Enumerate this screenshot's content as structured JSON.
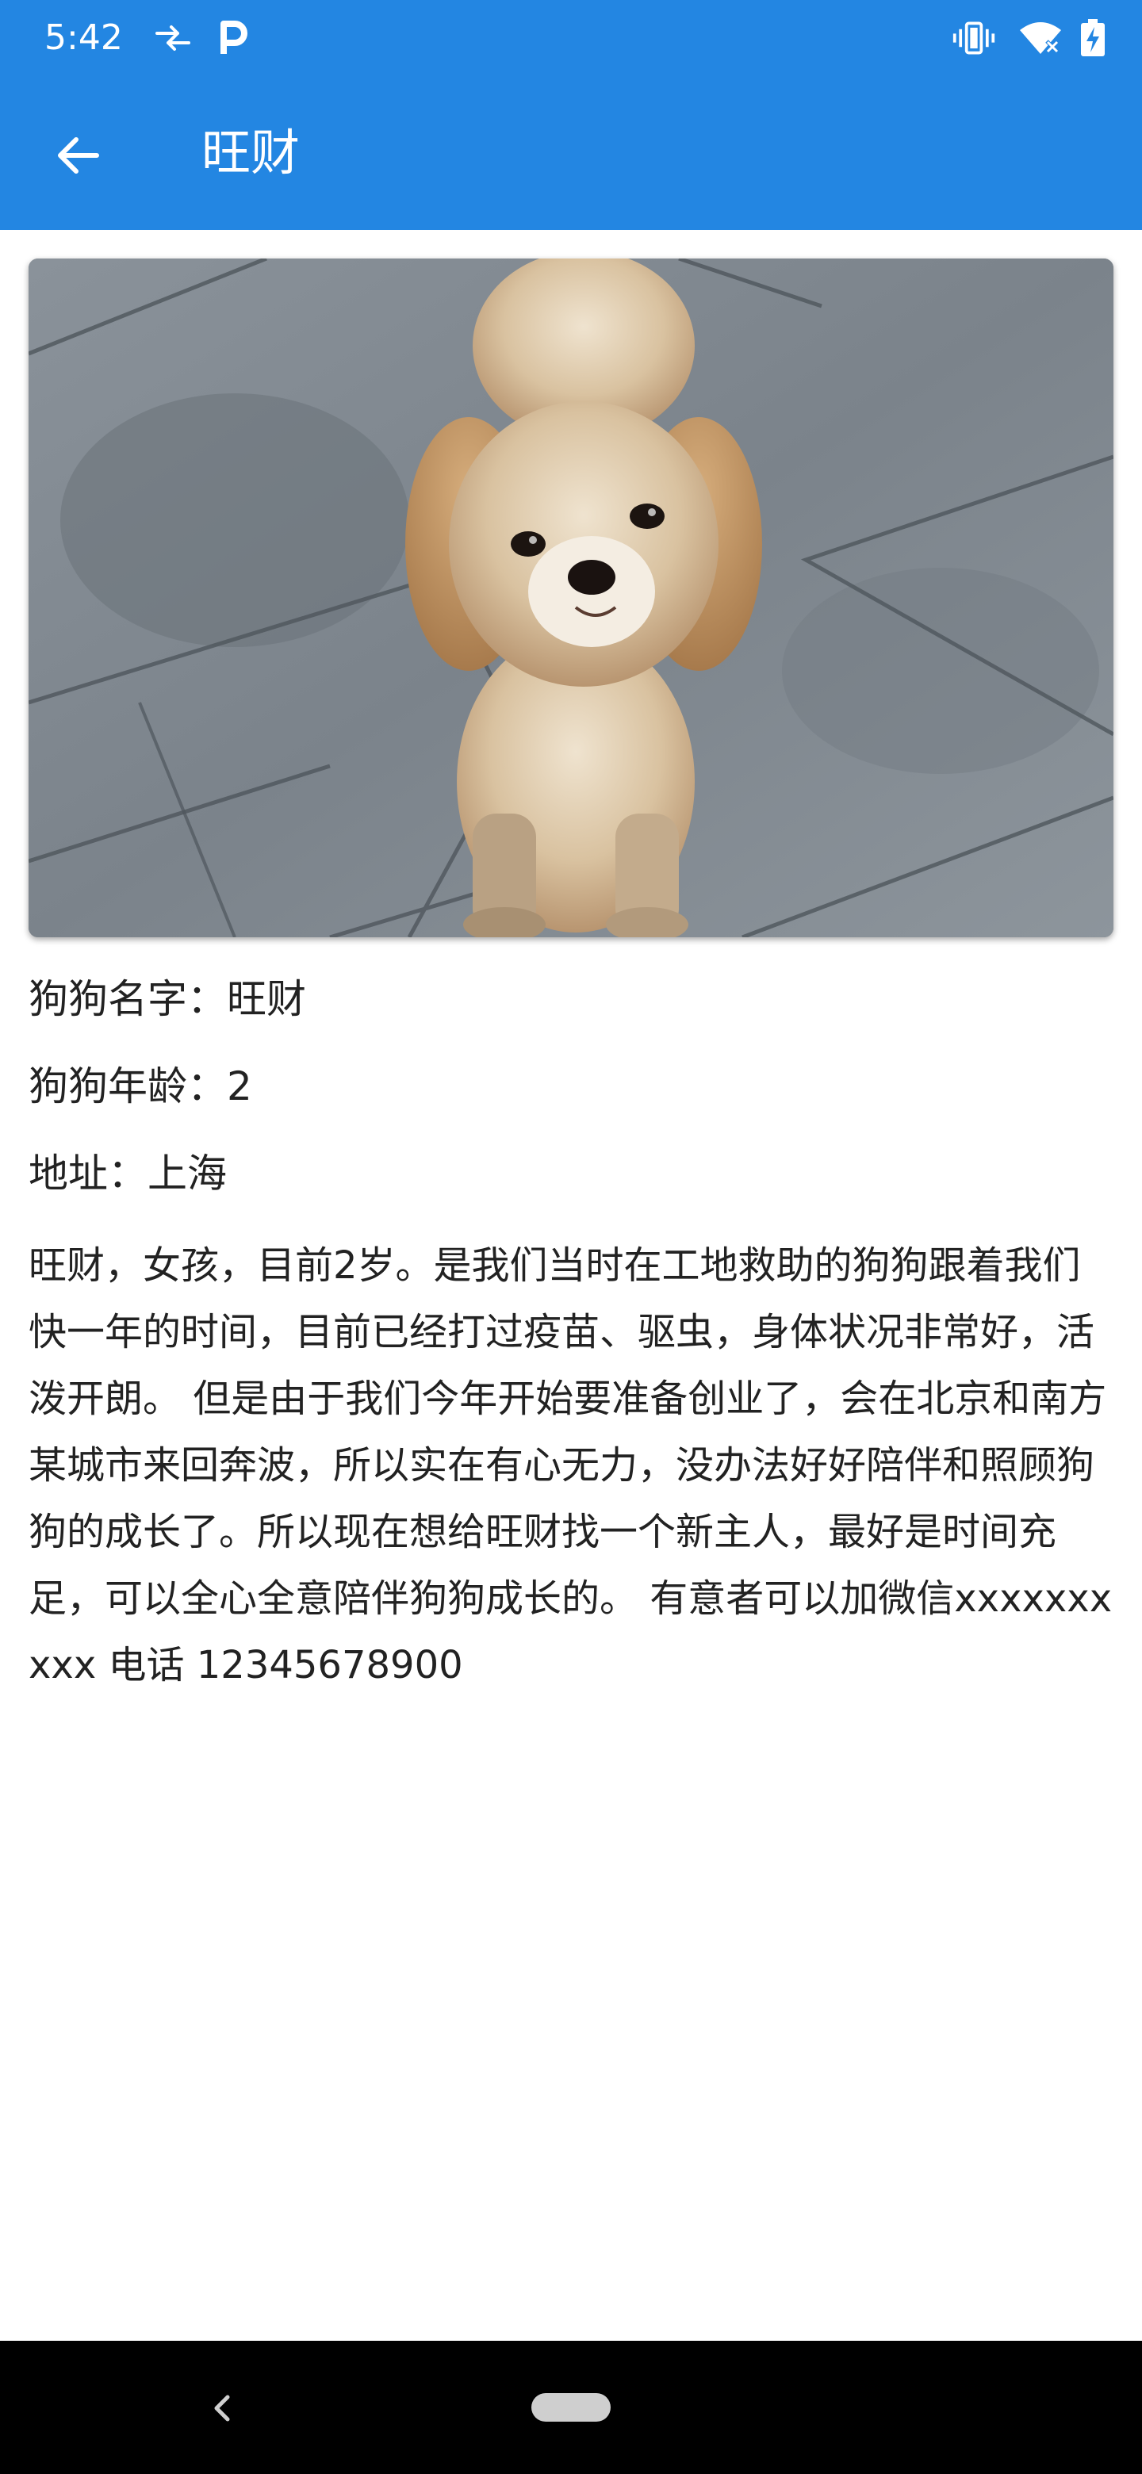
{
  "status_bar": {
    "time": "5:42",
    "icons": [
      "data-transfer-icon",
      "parking-icon",
      "vibrate-icon",
      "wifi-off-icon",
      "battery-charging-icon"
    ]
  },
  "app_bar": {
    "title": "旺财",
    "back_icon": "arrow-back-icon"
  },
  "dog": {
    "photo_alt": "dog-photo",
    "name_line": "狗狗名字：旺财",
    "age_line": "狗狗年龄：2",
    "address_line": "地址：上海",
    "description": "旺财，女孩，目前2岁。是我们当时在工地救助的狗狗跟着我们快一年的时间，目前已经打过疫苗、驱虫，身体状况非常好，活泼开朗。 但是由于我们今年开始要准备创业了，会在北京和南方某城市来回奔波，所以实在有心无力，没办法好好陪伴和照顾狗狗的成长了。所以现在想给旺财找一个新主人，最好是时间充足，可以全心全意陪伴狗狗成长的。 有意者可以加微信xxxxxxxxxx 电话 12345678900"
  },
  "colors": {
    "primary": "#2386e2",
    "nav_bar": "#000000",
    "text": "#222222"
  }
}
